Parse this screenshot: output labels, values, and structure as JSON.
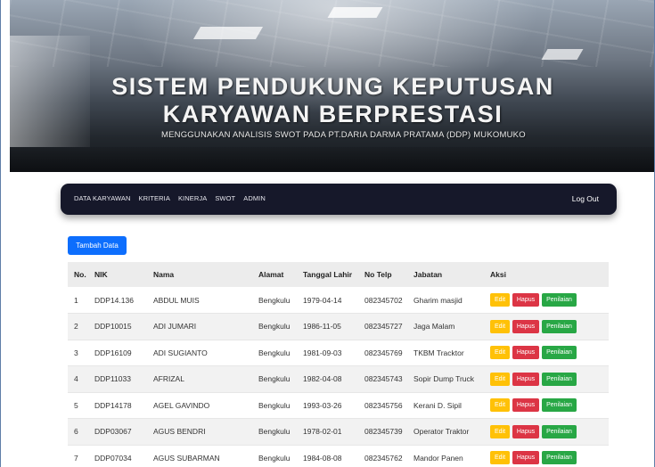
{
  "header": {
    "title_line1": "SISTEM PENDUKUNG KEPUTUSAN",
    "title_line2": "KARYAWAN BERPRESTASI",
    "subtitle": "MENGGUNAKAN ANALISIS SWOT PADA PT.DARIA DARMA PRATAMA (DDP) MUKOMUKO"
  },
  "nav": {
    "items": [
      "DATA KARYAWAN",
      "KRITERIA",
      "KINERJA",
      "SWOT",
      "ADMIN"
    ],
    "logout": "Log Out"
  },
  "add_button": "Tambah Data",
  "table": {
    "headers": [
      "No.",
      "NIK",
      "Nama",
      "Alamat",
      "Tanggal Lahir",
      "No Telp",
      "Jabatan",
      "Aksi"
    ],
    "action_labels": {
      "edit": "Edit",
      "hapus": "Hapus",
      "penilaian": "Penilaian"
    },
    "rows": [
      [
        "1",
        "DDP14.136",
        "ABDUL MUIS",
        "Bengkulu",
        "1979-04-14",
        "082345702",
        "Gharim masjid"
      ],
      [
        "2",
        "DDP10015",
        "ADI JUMARI",
        "Bengkulu",
        "1986-11-05",
        "082345727",
        "Jaga Malam"
      ],
      [
        "3",
        "DDP16109",
        "ADI SUGIANTO",
        "Bengkulu",
        "1981-09-03",
        "082345769",
        "TKBM Tracktor"
      ],
      [
        "4",
        "DDP11033",
        "AFRIZAL",
        "Bengkulu",
        "1982-04-08",
        "082345743",
        "Sopir Dump Truck"
      ],
      [
        "5",
        "DDP14178",
        "AGEL GAVINDO",
        "Bengkulu",
        "1993-03-26",
        "082345756",
        "Kerani D. Sipil"
      ],
      [
        "6",
        "DDP03067",
        "AGUS BENDRI",
        "Bengkulu",
        "1978-02-01",
        "082345739",
        "Operator Traktor"
      ],
      [
        "7",
        "DDP07034",
        "AGUS SUBARMAN",
        "Bengkulu",
        "1984-08-08",
        "082345762",
        "Mandor Panen"
      ]
    ]
  },
  "colors": {
    "navbar": "#16182a",
    "primary": "#0d6efd",
    "edit": "#ffc107",
    "hapus": "#dc3545",
    "penilaian": "#28a745"
  }
}
